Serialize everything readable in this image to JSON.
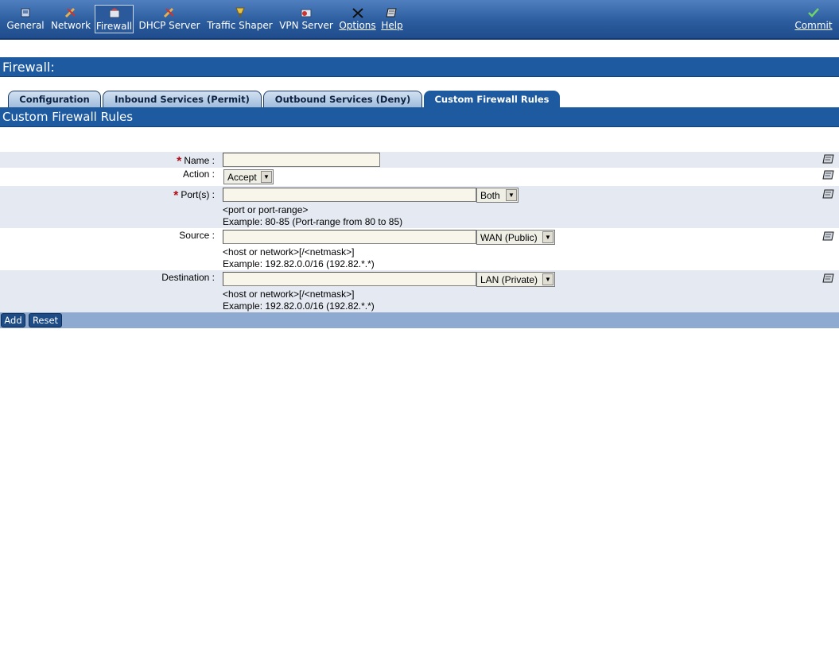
{
  "toolbar": {
    "items": [
      {
        "label": "General",
        "icon": "general-icon"
      },
      {
        "label": "Network",
        "icon": "network-icon"
      },
      {
        "label": "Firewall",
        "icon": "firewall-icon",
        "active": true
      },
      {
        "label": "DHCP Server",
        "icon": "dhcp-icon"
      },
      {
        "label": "Traffic Shaper",
        "icon": "traffic-shaper-icon"
      },
      {
        "label": "VPN Server",
        "icon": "vpn-icon"
      },
      {
        "label": "Options",
        "icon": "options-icon"
      },
      {
        "label": "Help",
        "icon": "help-book-icon"
      }
    ],
    "commit": {
      "label": "Commit",
      "icon": "checkmark-icon"
    }
  },
  "page": {
    "title": "Firewall:"
  },
  "tabs": [
    {
      "label": "Configuration"
    },
    {
      "label": "Inbound Services (Permit)"
    },
    {
      "label": "Outbound Services (Deny)"
    },
    {
      "label": "Custom Firewall Rules",
      "active": true
    }
  ],
  "section": {
    "title": "Custom Firewall Rules"
  },
  "form": {
    "name": {
      "label": "Name :",
      "required": true,
      "value": ""
    },
    "action": {
      "label": "Action :",
      "selected": "Accept"
    },
    "ports": {
      "label": "Port(s) :",
      "required": true,
      "value": "",
      "protocol": "Both",
      "hint1": "<port or port-range>",
      "hint2": "Example: 80-85 (Port-range from 80 to 85)"
    },
    "source": {
      "label": "Source :",
      "value": "",
      "interface": "WAN (Public)",
      "hint1": "<host or network>[/<netmask>]",
      "hint2": "Example: 192.82.0.0/16 (192.82.*.*)"
    },
    "destination": {
      "label": "Destination :",
      "value": "",
      "interface": "LAN (Private)",
      "hint1": "<host or network>[/<netmask>]",
      "hint2": "Example: 192.82.0.0/16 (192.82.*.*)"
    },
    "required_mark": "*"
  },
  "buttons": {
    "add": "Add",
    "reset": "Reset"
  },
  "colors": {
    "header_blue": "#1d5aa0",
    "row_shade": "#e4e9f2",
    "button_bar": "#8faad0",
    "required_red": "#b0101a"
  }
}
